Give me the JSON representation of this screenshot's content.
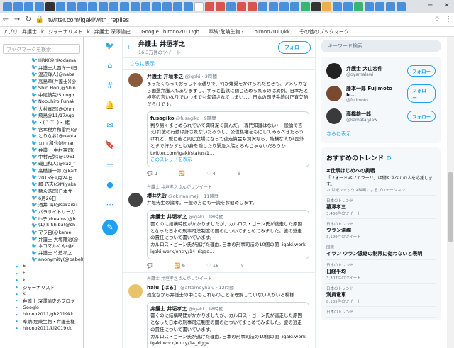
{
  "browser": {
    "url": "twitter.com/igaki/with_replies",
    "bookmarks": [
      "アプリ",
      "弁護士",
      "k",
      "ジャーナリスト",
      "k",
      "弁護士 深澤諭史 …",
      "Google",
      "hirono2011/gh…",
      "奉納:危険生物・…",
      "hirono2011/kk…",
      "その他のブックマーク"
    ]
  },
  "sidebar": {
    "search_placeholder": "ブックマークを検索",
    "items": [
      "HRK(@hKodama",
      "弁護士大西洋一(旧",
      "渡辺輝人(@nabe",
      "高島章(弁護士)(@",
      "Shin Hori(@Shin",
      "中尾慎哉/Shingo",
      "Nobuhiro Funak",
      "大村真司(@Ohm",
      "飛鳥@11/17Aqo",
      "・(-゜ ̄゜)・ 緒",
      "宮本税弁和雷門(@",
      "とりなお(@naota",
      "丸山 和也(@mar",
      "弁護士 中村憲司(",
      "中村元弥(@1961",
      "磯山和人(@kaz_f",
      "高橋謙一郎(@kart",
      "2015年9月24日",
      "郡 巧志(@Miyake",
      "穂永浩司(日本サ",
      "6月26日",
      "酒井 将(@sakaisu",
      "パラサイトリーガ",
      "in子(dreams(@b",
      "(1) S.Shiba(@sh",
      "マラ白(@kame_i",
      "弁護士 大塚隆治(@",
      "ネコマルくん(@r",
      "弁護士 竹迫孝之",
      "anonymity(@babel(",
      "E",
      "F",
      "k",
      "ジャーナリスト",
      "k",
      "弁護士 深澤諭史のブログ",
      "Google",
      "hirono2011/gh2019kk",
      "奉納:危険生物・弁護士様",
      "hirono2011/ki2019kk"
    ]
  },
  "profile": {
    "name": "弁護士 井垣孝之",
    "tweet_count": "16.3万件のツイート",
    "follow_label": "フォロー",
    "show_more": "さらに表示"
  },
  "tweets": [
    {
      "name": "弁護士 井垣孝之",
      "handle": "@igaki · 3時間",
      "text": "まったくもっておっしゃる通りで、何か嫌疑をかけられたときも、アメリカなら国選弁護人もありますし、ずっと監獄に閉じ込められるのは異例。日本だと検察の言いなりでいつまでも勾留されてしまい、、、日本の司法手続は正直欠陥だらけです。",
      "quote_name": "fusagiko",
      "quote_handle": "@fusagiko · 9時間",
      "quote_text": "判り易くまとめられていて興味深く読んだ。(専門知識はない) 一般論で言えば(彼の行動は許されないだろうし、公僕私権をもにしてみるべきだろうけれど、仮に彼と同じ立場になって逃走資金も潤沢なら、結構な人が(国外とまで行かずとも)身を隠したり緊急入院するんじゃないだろうか……",
      "quote_link": "twitter.com/igaki/status/1…",
      "thread": "このスレッドを表示",
      "reply": "1",
      "retweet": "",
      "like": "4"
    },
    {
      "retweet_by": "弁護士 井垣孝之さんがリツイート",
      "name": "櫻井先政",
      "handle": "@okinanimeji · 11時間",
      "text": "井垣先生の論考。一般の方にも一読をお勧めします。",
      "quote_name": "弁護士 井垣孝之",
      "quote_handle": "@igaki · 18時間",
      "quote_text": "書くのに結構時間がかかりましたが、カルロス・ゴーン氏が逃走した原因となった日本の刑事司法制度の闇のについてまとめてみました。彼の逃走の責任について書いています。",
      "link_text": "カルロス・ゴーン氏が逃げた理由, 日本の刑事司法の10個の闇 -igaki.work igaki.work/entry/14_rigge…",
      "reply": "",
      "retweet": "6",
      "like": "18"
    },
    {
      "retweet_by": "弁護士 井垣孝之さんがリツイート",
      "name": "halu【ほる】",
      "handle": "@attorneyhalu · 12時間",
      "text": "残念ながら弁護士の中にもこれらのことを理解していない人がいる模様…",
      "quote_name": "弁護士 井垣孝之",
      "quote_handle": "@igaki · 18時間",
      "quote_text": "書くのに結構時間がかかりましたが、カルロス・ゴーン氏が逃走した原因となった日本の刑事司法制度の闇のについてまとめてみました。彼の逃走の責任について書いています。",
      "link_text": "カルロス・ゴーン氏が逃げた理由, 日本の刑事司法の10個の闇 -igaki.work igaki.work/entry/14_rigge…"
    }
  ],
  "right": {
    "search_placeholder": "キーワード検索",
    "follow_label": "フォロー",
    "who": [
      {
        "name": "弁護士 大山宏仲",
        "handle": "@oyamalawi"
      },
      {
        "name": "藤本一郎 Fujimoto Ic…",
        "handle": "@fujimoto"
      },
      {
        "name": "高橋雄一郎",
        "handle": "@kamatalylaw"
      }
    ],
    "show_more": "さらに表示",
    "trends_title": "おすすめのトレンド",
    "promo_tag": "#仕事はじめへの挑戦",
    "promo_text": "「フォードvsフェラーリ」は働くすべての人を応援します。",
    "promo_by": "20世紀フォックス映画によるプロモーション",
    "trends": [
      {
        "label": "日本のトレンド",
        "name": "墓澤孝三",
        "count": "3,436件のツイート"
      },
      {
        "label": "日本のトレンド",
        "name": "ウラン濃縮",
        "count": "3,199件のツイート"
      },
      {
        "label": "国際",
        "name": "イラン ウラン濃縮の制限に従わないと表明",
        "count": ""
      },
      {
        "label": "日本のトレンド",
        "name": "日経平均",
        "count": "3,307件のツイート"
      },
      {
        "label": "日本のトレンド",
        "name": "満員電車",
        "count": "8,135件のツイート"
      },
      {
        "label": "日本のトレンド",
        "name": "",
        "count": ""
      }
    ]
  }
}
